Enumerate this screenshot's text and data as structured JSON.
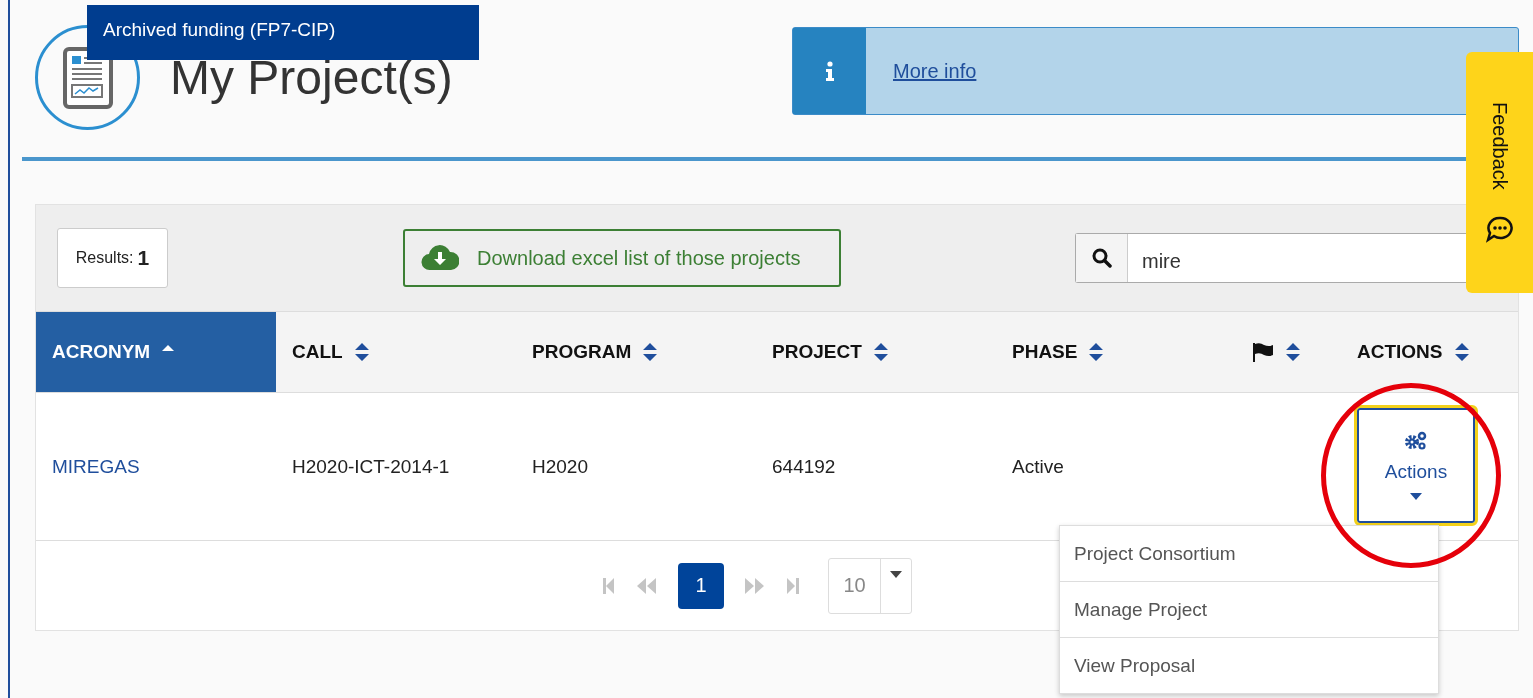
{
  "tooltip": "Archived funding (FP7-CIP)",
  "title": "My Project(s)",
  "info": {
    "link": "More info"
  },
  "feedback": {
    "label": "Feedback"
  },
  "toolbar": {
    "results_label": "Results:",
    "results_count": "1",
    "download": "Download excel list of those projects",
    "search": {
      "value": "mire"
    }
  },
  "table": {
    "columns": [
      {
        "kind": "text",
        "label": "ACRONYM",
        "sorted": true
      },
      {
        "kind": "text",
        "label": "CALL",
        "sorted": false
      },
      {
        "kind": "text",
        "label": "PROGRAM",
        "sorted": false
      },
      {
        "kind": "text",
        "label": "PROJECT",
        "sorted": false
      },
      {
        "kind": "text",
        "label": "PHASE",
        "sorted": false
      },
      {
        "kind": "flag",
        "sorted": false
      },
      {
        "kind": "text",
        "label": "ACTIONS",
        "sorted": false
      }
    ],
    "rows": [
      {
        "acronym": "MIREGAS",
        "call": "H2020-ICT-2014-1",
        "program": "H2020",
        "project": "644192",
        "phase": "Active",
        "actions": {
          "label": "Actions",
          "expanded": true,
          "highlighted": true
        }
      }
    ]
  },
  "pagination": {
    "pages": [
      {
        "label": "1",
        "selected": true
      }
    ],
    "first_disabled": true,
    "last_disabled": true,
    "page_size": "10"
  },
  "menu": [
    "Project Consortium",
    "Manage Project",
    "View Proposal"
  ]
}
